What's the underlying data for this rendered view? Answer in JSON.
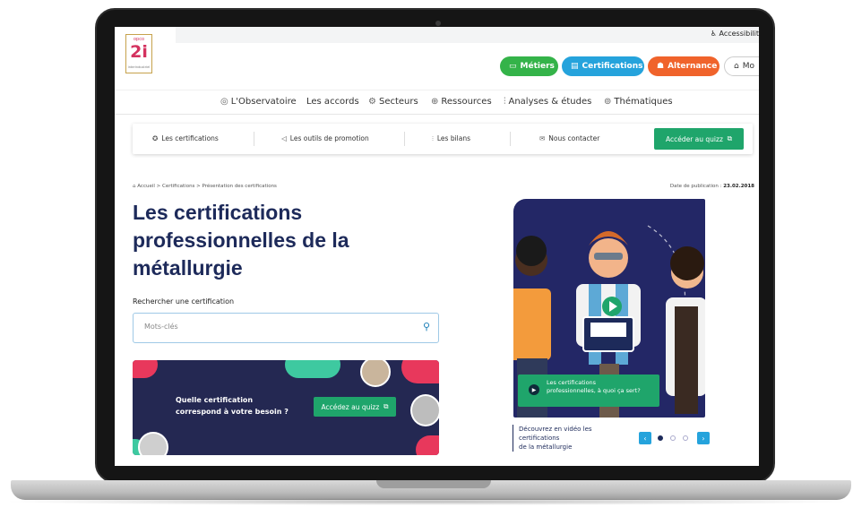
{
  "header": {
    "accessibility_label": "Accessibilit",
    "logo": {
      "top_text": "opco",
      "number": "2i",
      "sub_text": "interindustriel"
    },
    "pills": {
      "metiers": "Métiers",
      "certifications": "Certifications",
      "alternance": "Alternance",
      "account": "Mo"
    }
  },
  "nav": {
    "items": [
      {
        "label": "L'Observatoire",
        "icon": "globe-icon"
      },
      {
        "label": "Les accords",
        "icon": ""
      },
      {
        "label": "Secteurs",
        "icon": "gear-icon"
      },
      {
        "label": "Ressources",
        "icon": "search-globe-icon"
      },
      {
        "label": "Analyses & études",
        "icon": "chart-icon"
      },
      {
        "label": "Thématiques",
        "icon": "target-icon"
      }
    ]
  },
  "subnav": {
    "items": [
      {
        "label": "Les certifications",
        "icon": "medal-icon"
      },
      {
        "label": "Les outils de promotion",
        "icon": "megaphone-icon"
      },
      {
        "label": "Les bilans",
        "icon": "chart-icon"
      },
      {
        "label": "Nous contacter",
        "icon": "mail-icon"
      }
    ],
    "quiz_label": "Accéder au quizz"
  },
  "breadcrumb": "Accueil > Certifications > Présentation des certifications",
  "publication": {
    "label": "Date de publication :",
    "date": "23.02.2018"
  },
  "title": "Les certifications professionnelles de la métallurgie",
  "search": {
    "label": "Rechercher une certification",
    "placeholder": "Mots-clés"
  },
  "banner": {
    "question_line1": "Quelle certification",
    "question_line2": "correspond à votre besoin ?",
    "button_label": "Accédez au quizz"
  },
  "video": {
    "caption_line1": "Les certifications",
    "caption_line2": "professionnelles, à quoi ça sert?",
    "description_line1": "Découvrez en vidéo les certifications",
    "description_line2": "de la métallurgie"
  },
  "carousel": {
    "current": 1,
    "total": 3
  },
  "colors": {
    "navy": "#1d2a5a",
    "green": "#1fa56b",
    "pill_green": "#34b349",
    "blue": "#25a3dc",
    "orange": "#f0632b",
    "pink": "#e8385c",
    "teal": "#3ec9a0"
  }
}
